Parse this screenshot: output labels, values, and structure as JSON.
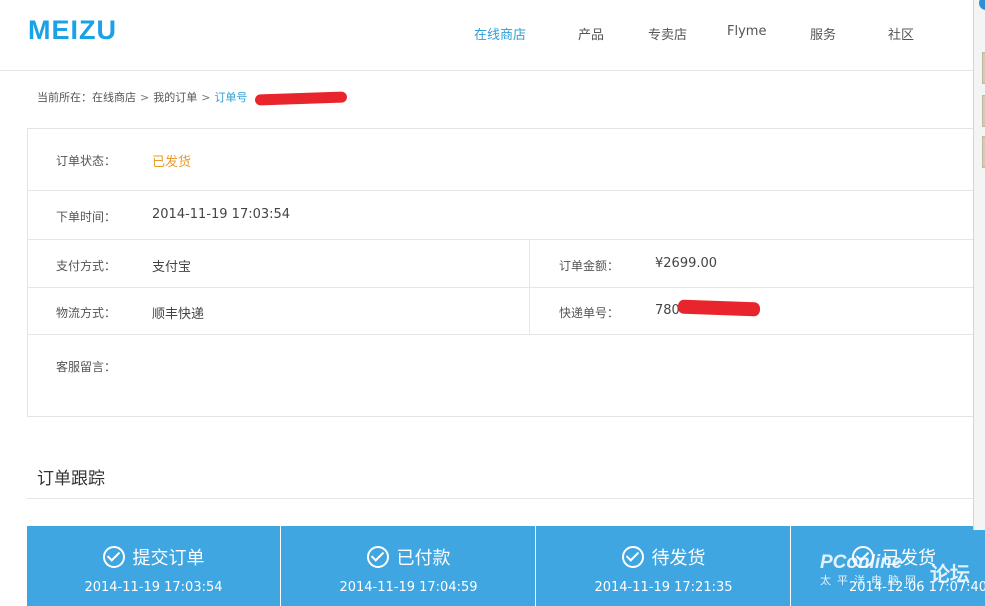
{
  "header": {
    "logo": "MEIZU",
    "nav": [
      {
        "label": "在线商店",
        "active": true
      },
      {
        "label": "产品",
        "active": false
      },
      {
        "label": "专卖店",
        "active": false
      },
      {
        "label": "Flyme",
        "active": false
      },
      {
        "label": "服务",
        "active": false
      },
      {
        "label": "社区",
        "active": false
      }
    ]
  },
  "breadcrumb": {
    "prefix": "当前所在：",
    "items": [
      "在线商店",
      "我的订单"
    ],
    "separator": ">",
    "current": "订单号"
  },
  "order": {
    "status_label": "订单状态：",
    "status_value": "已发货",
    "time_label": "下单时间：",
    "time_value": "2014-11-19 17:03:54",
    "payment_label": "支付方式：",
    "payment_value": "支付宝",
    "amount_label": "订单金额：",
    "amount_value": "¥2699.00",
    "shipping_label": "物流方式：",
    "shipping_value": "顺丰快递",
    "tracking_label": "快递单号：",
    "tracking_value": "780",
    "remark_label": "客服留言："
  },
  "tracking": {
    "title": "订单跟踪",
    "steps": [
      {
        "title": "提交订单",
        "time": "2014-11-19 17:03:54"
      },
      {
        "title": "已付款",
        "time": "2014-11-19 17:04:59"
      },
      {
        "title": "待发货",
        "time": "2014-11-19 17:21:35"
      },
      {
        "title": "已发货",
        "time": "2014-12-06 17:07:40"
      }
    ]
  },
  "watermark": {
    "brand": "PConline",
    "sub": "太平洋电脑网",
    "forum": "论坛"
  },
  "colors": {
    "brand": "#1aa2e6",
    "nav_active": "#2f9fd6",
    "status": "#e89b2b",
    "steps_bg": "#3fa6e2",
    "redaction": "#e8242c"
  }
}
